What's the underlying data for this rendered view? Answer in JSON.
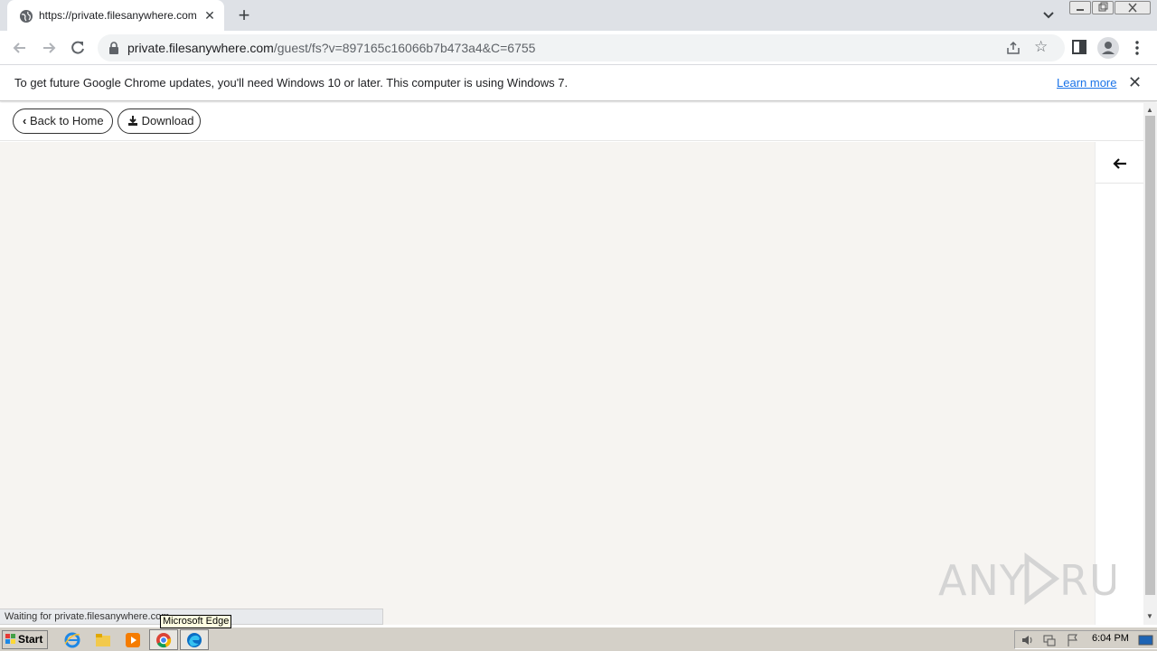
{
  "browser": {
    "tab": {
      "title": "https://private.filesanywhere.com/g",
      "close": "✕"
    },
    "new_tab": "+",
    "address": {
      "host": "private.filesanywhere.com",
      "path": "/guest/fs?v=897165c16066b7b473a4&C=6755"
    },
    "infobar": {
      "message": "To get future Google Chrome updates, you'll need Windows 10 or later. This computer is using Windows 7.",
      "learn_more": "Learn more",
      "close": "✕"
    },
    "status": "Waiting for private.filesanywhere.com..."
  },
  "page": {
    "back_label": "Back to Home",
    "download_label": "Download"
  },
  "watermark": "ANY RUN",
  "taskbar": {
    "start_label": "Start",
    "tooltip": "Microsoft Edge",
    "clock": "6:04 PM"
  }
}
